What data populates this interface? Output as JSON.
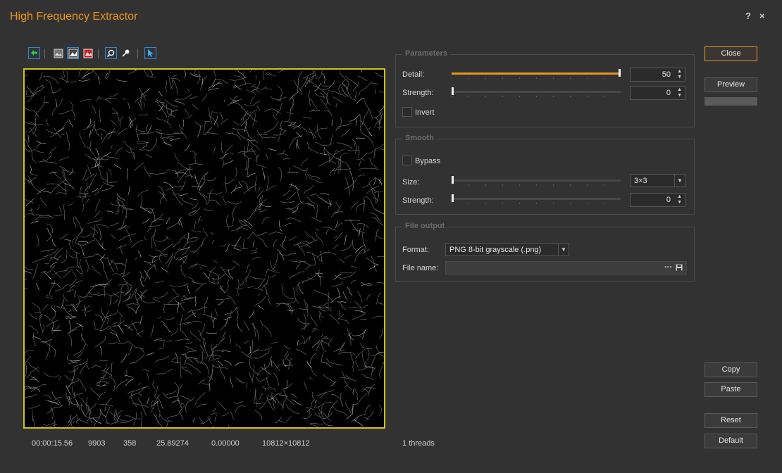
{
  "window": {
    "title": "High Frequency Extractor",
    "help_glyph": "?",
    "close_glyph": "×",
    "accent_color": "#e8961f",
    "frame_color": "#c8c320"
  },
  "toolbar": {
    "icons": [
      "back-arrow-icon",
      "image-mode-icon",
      "image-color-icon",
      "image-red-icon",
      "zoom-fit-icon",
      "picker-icon",
      "pointer-icon"
    ]
  },
  "statusbar": {
    "time": "00:00:15.56",
    "v1": "9903",
    "v2": "358",
    "v3": "25.89274",
    "v4": "0.00000",
    "size": "10812×10812",
    "threads": "1 threads"
  },
  "parameters": {
    "legend": "Parameters",
    "detail_label": "Detail:",
    "detail_value": "50",
    "detail_fraction": 1.0,
    "strength_label": "Strength:",
    "strength_value": "0",
    "strength_fraction": 0.0,
    "invert_label": "Invert",
    "invert_checked": false
  },
  "smooth": {
    "legend": "Smooth",
    "bypass_label": "Bypass",
    "bypass_checked": false,
    "size_label": "Size:",
    "size_value": "3×3",
    "size_fraction": 0.0,
    "strength_label": "Strength:",
    "strength_value": "0",
    "strength_fraction": 0.0
  },
  "file_output": {
    "legend": "File output",
    "format_label": "Format:",
    "format_value": "PNG 8-bit grayscale (.png)",
    "filename_label": "File name:",
    "filename_value": "",
    "browse_glyph": "···"
  },
  "buttons": {
    "close": "Close",
    "preview": "Preview",
    "copy": "Copy",
    "paste": "Paste",
    "reset": "Reset",
    "default": "Default"
  }
}
